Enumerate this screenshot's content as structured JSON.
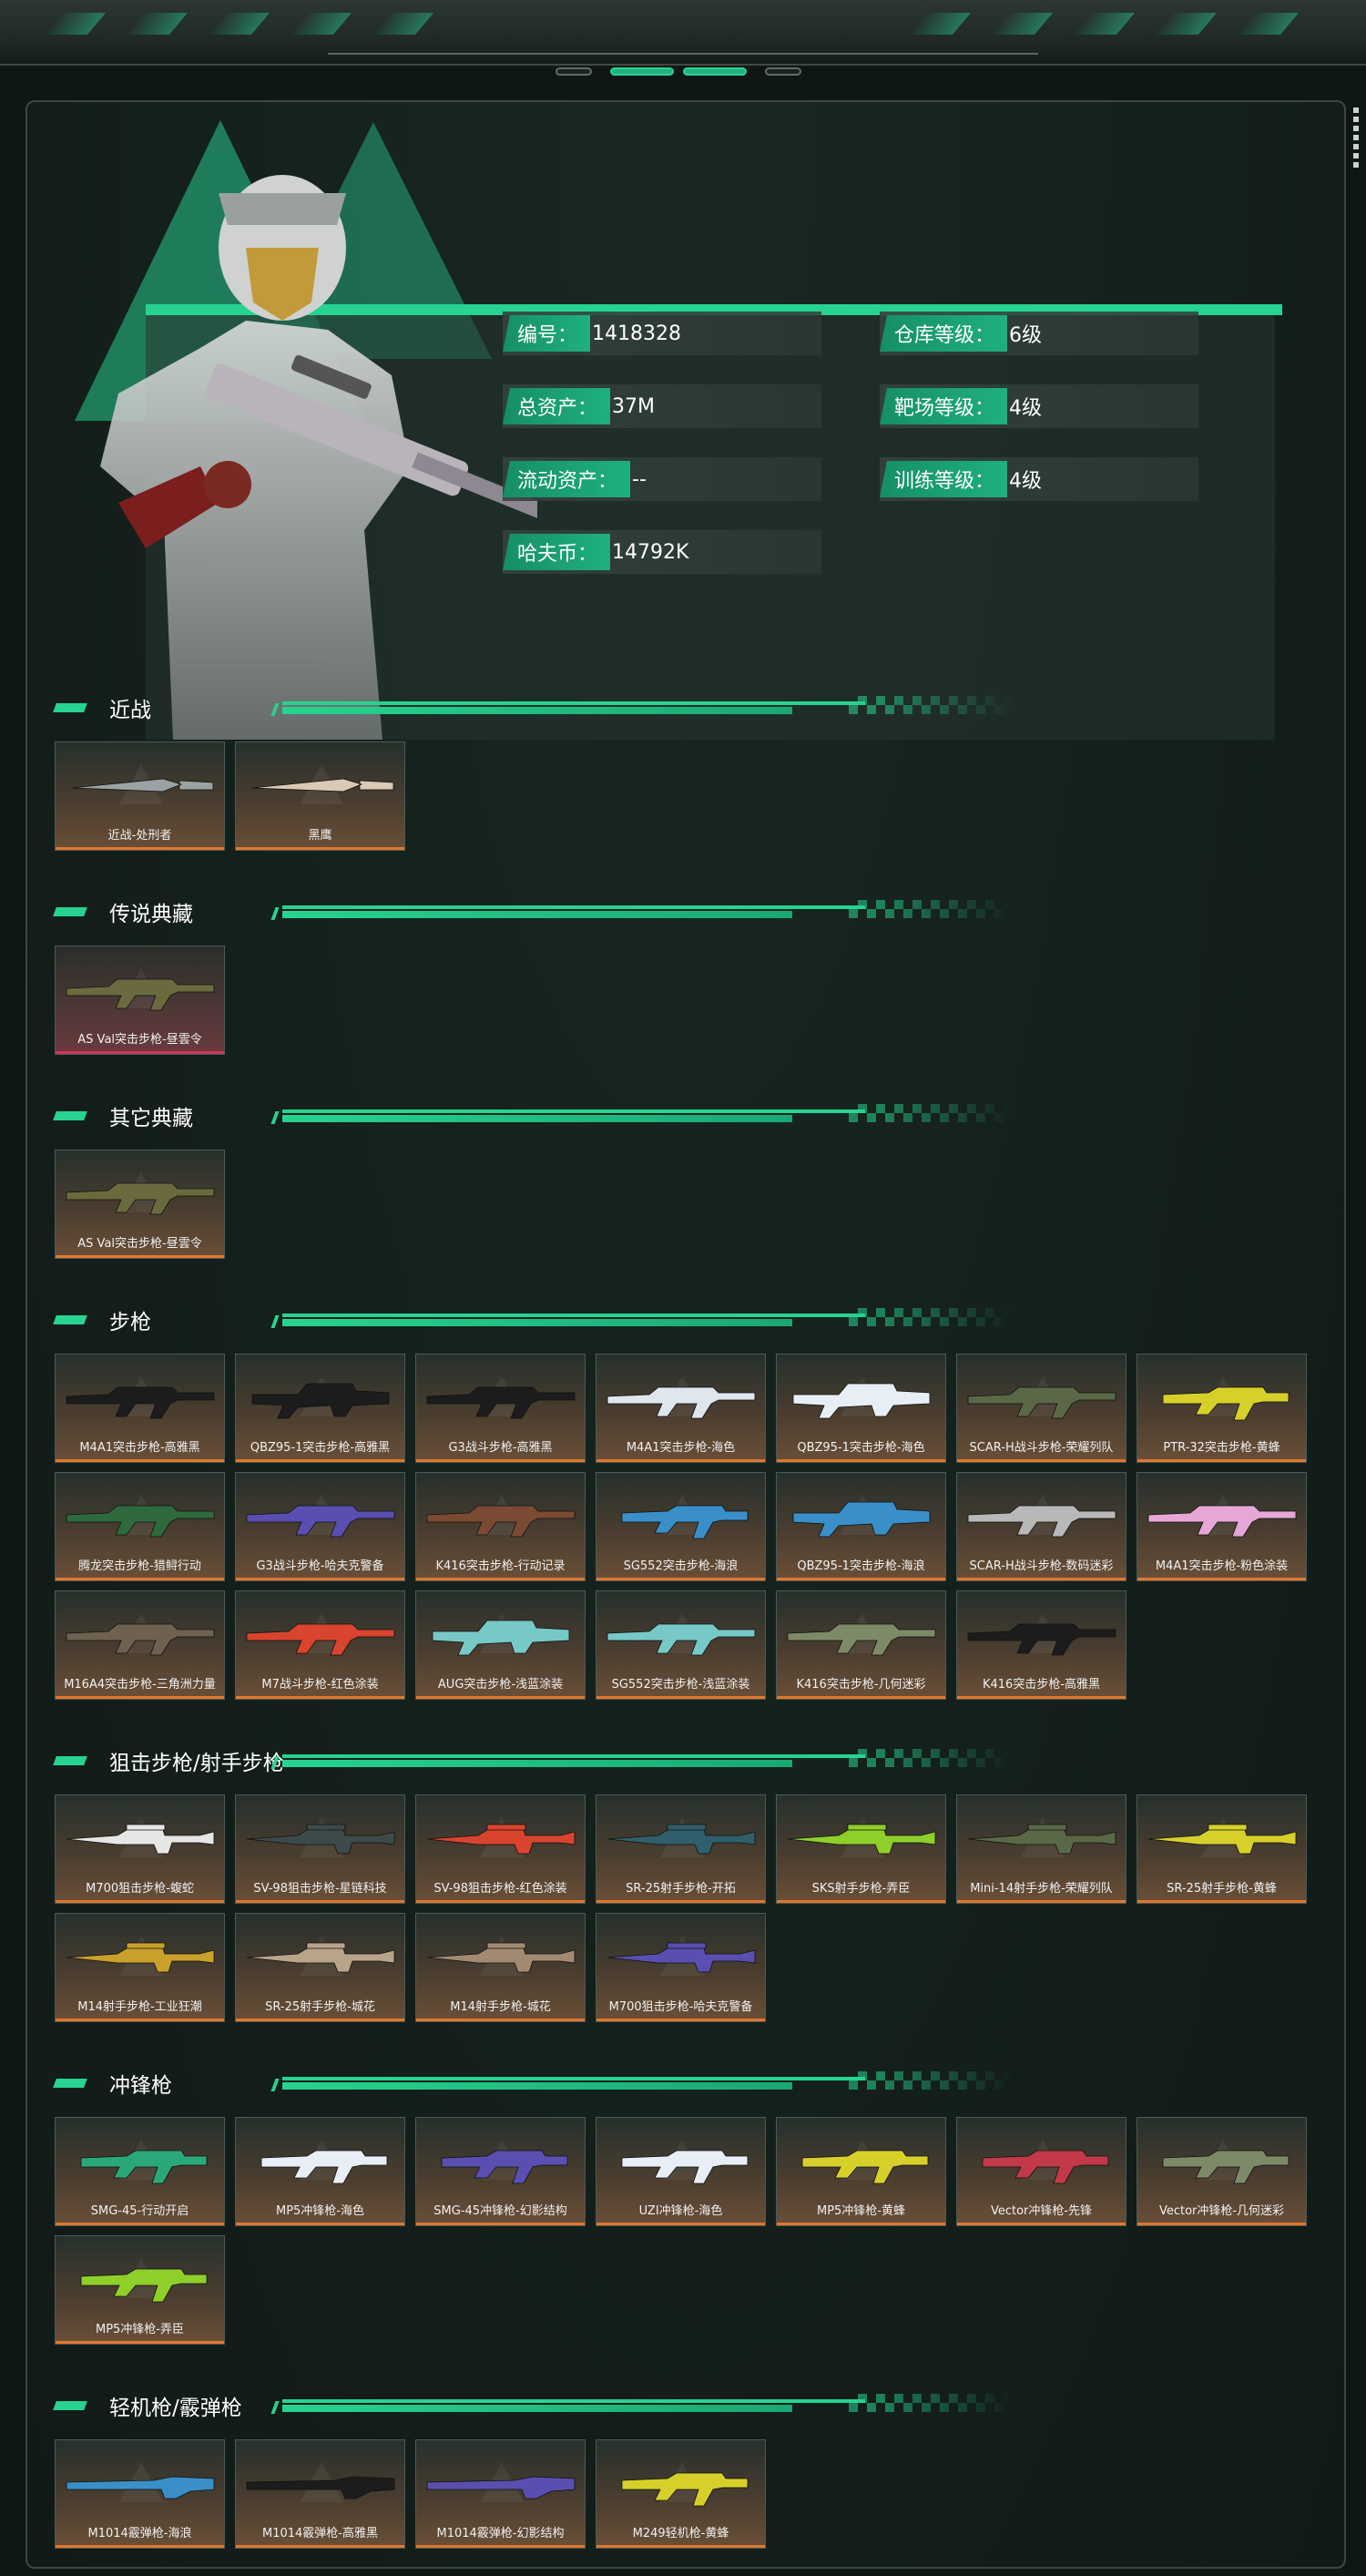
{
  "colors": {
    "accent": "#27d38f",
    "card_bottom": "#e0772e",
    "legend_bottom": "#d8335a",
    "bg": "#0f1714"
  },
  "profile": {
    "stats": [
      {
        "label": "编号：",
        "value": "1418328"
      },
      {
        "label": "仓库等级：",
        "value": "6级"
      },
      {
        "label": "总资产：",
        "value": "37M"
      },
      {
        "label": "靶场等级：",
        "value": "4级"
      },
      {
        "label": "流动资产：",
        "value": "--"
      },
      {
        "label": "训练等级：",
        "value": "4级"
      },
      {
        "label": "哈夫币：",
        "value": "14792K"
      }
    ]
  },
  "sections": [
    {
      "title": "近战",
      "rarity": "normal",
      "items": [
        {
          "name": "近战-处刑者",
          "gun": "knife-dark",
          "color": "#9aa2a4"
        },
        {
          "name": "黑鹰",
          "gun": "knife-light",
          "color": "#d9c9b5"
        }
      ]
    },
    {
      "title": "传说典藏",
      "rarity": "legend",
      "items": [
        {
          "name": "AS Val突击步枪-昼雲令",
          "gun": "rifle",
          "color": "#6b6a3e"
        }
      ]
    },
    {
      "title": "其它典藏",
      "rarity": "normal",
      "items": [
        {
          "name": "AS Val突击步枪-昼雲令",
          "gun": "rifle",
          "color": "#6b6a3e"
        }
      ]
    },
    {
      "title": "步枪",
      "rarity": "normal",
      "items": [
        {
          "name": "M4A1突击步枪-高雅黑",
          "gun": "rifle",
          "color": "#1c1c1c"
        },
        {
          "name": "QBZ95-1突击步枪-高雅黑",
          "gun": "bullpup",
          "color": "#1c1c1c"
        },
        {
          "name": "G3战斗步枪-高雅黑",
          "gun": "rifle",
          "color": "#1c1c1c"
        },
        {
          "name": "M4A1突击步枪-海色",
          "gun": "rifle",
          "color": "#dfe6ee"
        },
        {
          "name": "QBZ95-1突击步枪-海色",
          "gun": "bullpup",
          "color": "#e8eef5"
        },
        {
          "name": "SCAR-H战斗步枪-荣耀列队",
          "gun": "rifle",
          "color": "#5a6848"
        },
        {
          "name": "PTR-32突击步枪-黄蜂",
          "gun": "smg",
          "color": "#d7d02a"
        },
        {
          "name": "腾龙突击步枪-猎鲟行动",
          "gun": "rifle",
          "color": "#2e6a3d"
        },
        {
          "name": "G3战斗步枪-哈夫克警备",
          "gun": "rifle",
          "color": "#5a4fb0"
        },
        {
          "name": "K416突击步枪-行动记录",
          "gun": "rifle",
          "color": "#7a4a33"
        },
        {
          "name": "SG552突击步枪-海浪",
          "gun": "smg",
          "color": "#3a8fc8"
        },
        {
          "name": "QBZ95-1突击步枪-海浪",
          "gun": "bullpup",
          "color": "#3a8fc8"
        },
        {
          "name": "SCAR-H战斗步枪-数码迷彩",
          "gun": "rifle",
          "color": "#b8b8b8"
        },
        {
          "name": "M4A1突击步枪-粉色涂装",
          "gun": "rifle",
          "color": "#e6a6d6"
        },
        {
          "name": "M16A4突击步枪-三角洲力量",
          "gun": "rifle",
          "color": "#6e6150"
        },
        {
          "name": "M7战斗步枪-红色涂装",
          "gun": "rifle",
          "color": "#d9442e"
        },
        {
          "name": "AUG突击步枪-浅蓝涂装",
          "gun": "bullpup",
          "color": "#76c9c6"
        },
        {
          "name": "SG552突击步枪-浅蓝涂装",
          "gun": "rifle",
          "color": "#76c9c6"
        },
        {
          "name": "K416突击步枪-几何迷彩",
          "gun": "rifle",
          "color": "#7d8a67"
        },
        {
          "name": "K416突击步枪-高雅黑",
          "gun": "rifle",
          "color": "#1c1c1c"
        }
      ]
    },
    {
      "title": "狙击步枪/射手步枪",
      "rarity": "normal",
      "items": [
        {
          "name": "M700狙击步枪-蝮蛇",
          "gun": "sniper",
          "color": "#e6e6e6"
        },
        {
          "name": "SV-98狙击步枪-星链科技",
          "gun": "sniper",
          "color": "#3d4a4a"
        },
        {
          "name": "SV-98狙击步枪-红色涂装",
          "gun": "sniper",
          "color": "#d9442e"
        },
        {
          "name": "SR-25射手步枪-开拓",
          "gun": "sniper",
          "color": "#2f5f6a"
        },
        {
          "name": "SKS射手步枪-弄臣",
          "gun": "sniper",
          "color": "#8fcf2a"
        },
        {
          "name": "Mini-14射手步枪-荣耀列队",
          "gun": "sniper",
          "color": "#5a6848"
        },
        {
          "name": "SR-25射手步枪-黄蜂",
          "gun": "sniper",
          "color": "#d7d02a"
        },
        {
          "name": "M14射手步枪-工业狂潮",
          "gun": "sniper",
          "color": "#c9a02a"
        },
        {
          "name": "SR-25射手步枪-城花",
          "gun": "sniper",
          "color": "#b9a48a"
        },
        {
          "name": "M14射手步枪-城花",
          "gun": "sniper",
          "color": "#a28a72"
        },
        {
          "name": "M700狙击步枪-哈夫克警备",
          "gun": "sniper",
          "color": "#5a4fb0"
        }
      ]
    },
    {
      "title": "冲锋枪",
      "rarity": "normal",
      "items": [
        {
          "name": "SMG-45-行动开启",
          "gun": "smg",
          "color": "#2aa87a"
        },
        {
          "name": "MP5冲锋枪-海色",
          "gun": "smg",
          "color": "#e8eef5"
        },
        {
          "name": "SMG-45冲锋枪-幻影结构",
          "gun": "smg",
          "color": "#5a4fb0"
        },
        {
          "name": "UZI冲锋枪-海色",
          "gun": "smg",
          "color": "#e8eef5"
        },
        {
          "name": "MP5冲锋枪-黄蜂",
          "gun": "smg",
          "color": "#d7d02a"
        },
        {
          "name": "Vector冲锋枪-先锋",
          "gun": "smg",
          "color": "#c23a4a"
        },
        {
          "name": "Vector冲锋枪-几何迷彩",
          "gun": "smg",
          "color": "#7d8a67"
        },
        {
          "name": "MP5冲锋枪-弄臣",
          "gun": "smg",
          "color": "#8fcf2a"
        }
      ]
    },
    {
      "title": "轻机枪/霰弹枪",
      "rarity": "normal",
      "items": [
        {
          "name": "M1014霰弹枪-海浪",
          "gun": "shotgun",
          "color": "#3a8fc8"
        },
        {
          "name": "M1014霰弹枪-高雅黑",
          "gun": "shotgun",
          "color": "#1c1c1c"
        },
        {
          "name": "M1014霰弹枪-幻影结构",
          "gun": "shotgun",
          "color": "#5a4fb0"
        },
        {
          "name": "M249轻机枪-黄蜂",
          "gun": "smg",
          "color": "#d7d02a"
        }
      ]
    }
  ]
}
